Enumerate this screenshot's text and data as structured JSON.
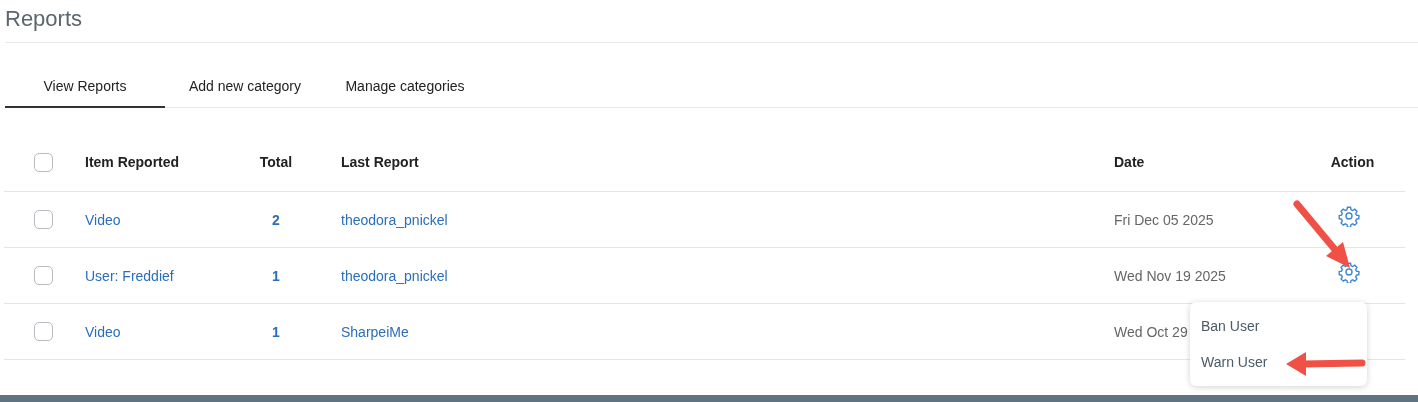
{
  "page": {
    "title": "Reports"
  },
  "tabs": [
    {
      "label": "View Reports",
      "selected": true
    },
    {
      "label": "Add new category",
      "selected": false
    },
    {
      "label": "Manage categories",
      "selected": false
    }
  ],
  "table": {
    "select_all": {
      "checked": false
    },
    "columns": [
      "Item Reported",
      "Total",
      "Last Report",
      "Date",
      "Action"
    ],
    "rows": [
      {
        "checked": false,
        "item": "Video",
        "total": "2",
        "last_report": "theodora_pnickel",
        "date": "Fri Dec 05 2025",
        "kind": "with_gear"
      },
      {
        "checked": false,
        "item": "User: Freddief",
        "total": "1",
        "last_report": "theodora_pnickel",
        "date": "Wed Nov 19 2025",
        "kind": "with_gear"
      },
      {
        "checked": false,
        "item": "Video",
        "total": "1",
        "last_report": "SharpeiMe",
        "date": "Wed Oct 29",
        "kind": "covered"
      }
    ]
  },
  "action_menu": {
    "items": [
      "Ban User",
      "Warn User"
    ]
  }
}
